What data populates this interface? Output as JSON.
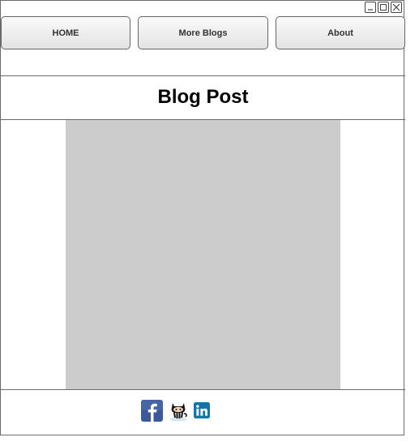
{
  "window": {
    "controls": [
      "minimize-icon",
      "maximize-icon",
      "close-icon"
    ]
  },
  "nav": {
    "home_label": "HOME",
    "more_blogs_label": "More Blogs",
    "about_label": "About"
  },
  "header": {
    "title": "Blog Post"
  },
  "content": {
    "image_placeholder_color": "#cccccc"
  },
  "footer": {
    "social": [
      "facebook-icon",
      "github-octocat-icon",
      "linkedin-icon"
    ]
  },
  "colors": {
    "facebook": "#3b5998",
    "linkedin": "#0e76a8",
    "border": "#6b6b6b"
  }
}
